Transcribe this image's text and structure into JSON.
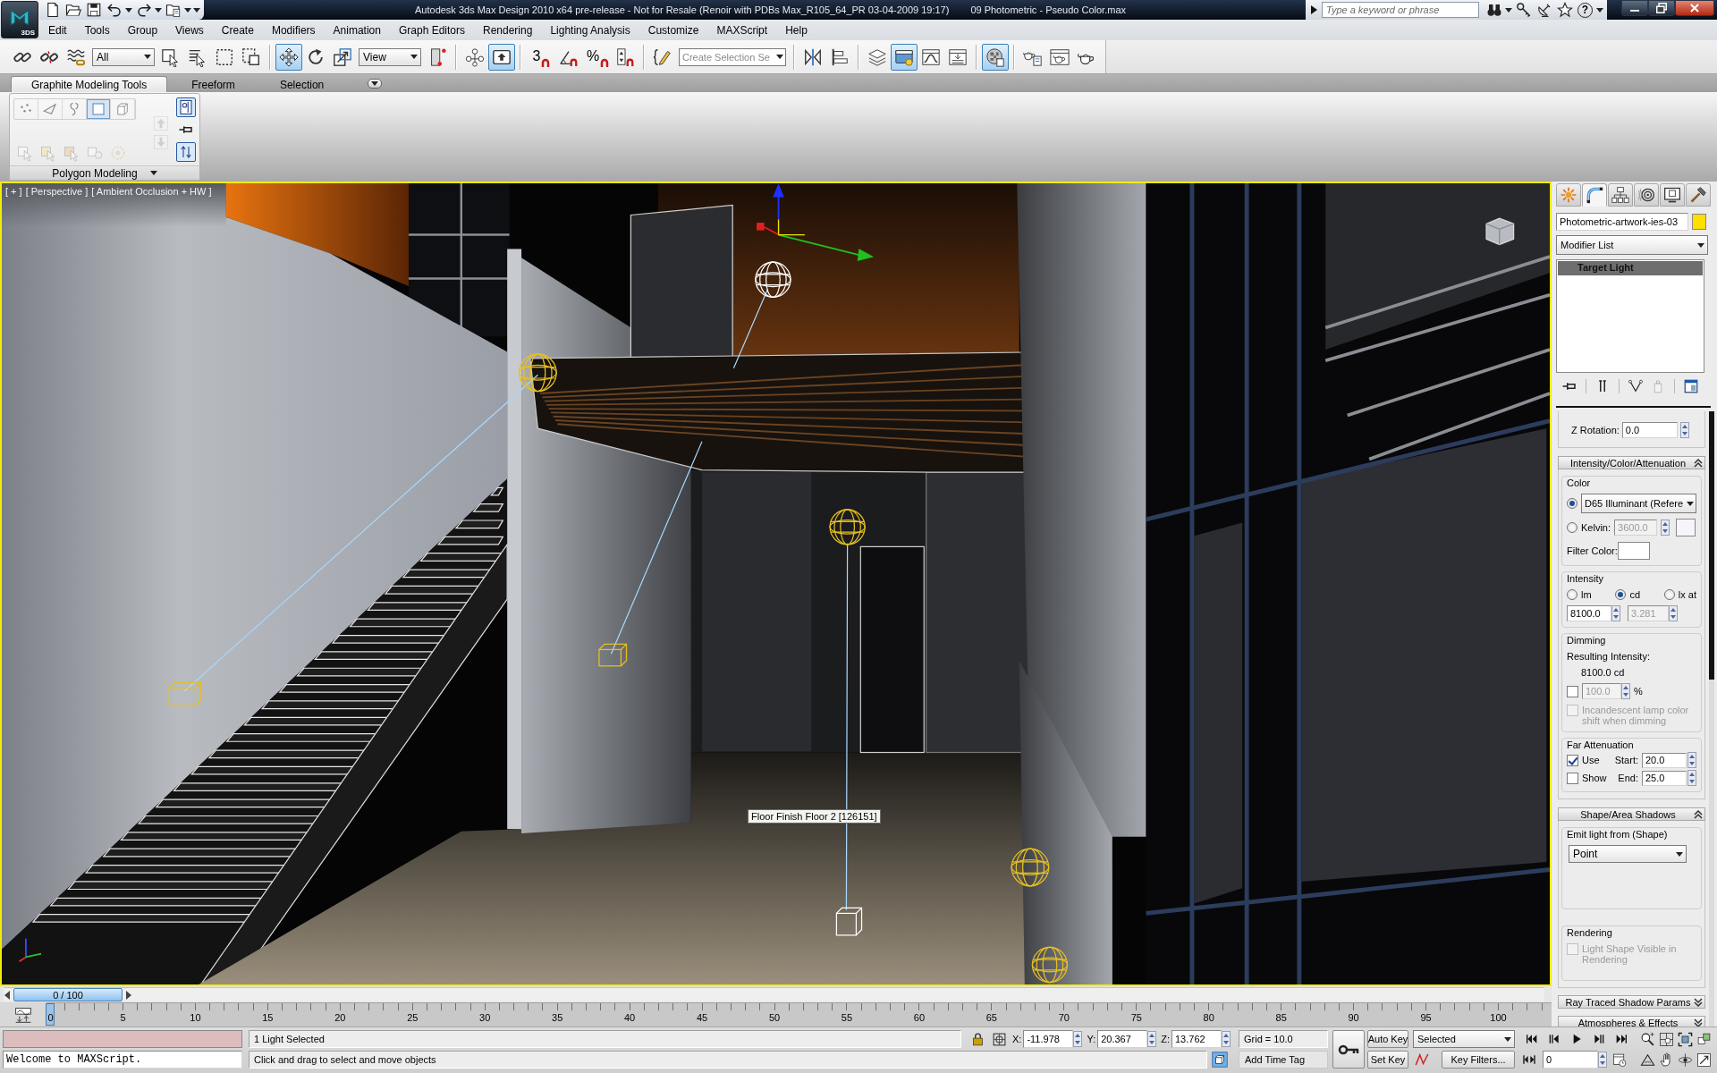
{
  "title_bar": {
    "app_button": {
      "label": "3DS"
    },
    "quick_access": [
      {
        "kind": "new"
      },
      {
        "kind": "open"
      },
      {
        "kind": "save"
      },
      {
        "kind": "undo",
        "menu": true
      },
      {
        "kind": "redo",
        "menu": true
      },
      {
        "kind": "project",
        "menu": true
      },
      {
        "kind": "customize"
      }
    ],
    "title": "Autodesk 3ds Max Design 2010 x64 pre-release - Not for Resale (Renoir with PDBs Max_R105_64_PR 03-04-2009 19:17)",
    "file_name": "09 Photometric - Pseudo Color.max",
    "search": {
      "placeholder": "Type a keyword or phrase"
    },
    "infocenter": [
      {
        "kind": "binoculars",
        "menu": true
      },
      {
        "kind": "key"
      },
      {
        "kind": "satellite"
      },
      {
        "kind": "star"
      },
      {
        "kind": "help",
        "glyph": "?",
        "menu": true
      }
    ]
  },
  "menu_bar": [
    "Edit",
    "Tools",
    "Group",
    "Views",
    "Create",
    "Modifiers",
    "Animation",
    "Graph Editors",
    "Rendering",
    "Lighting Analysis",
    "Customize",
    "MAXScript",
    "Help"
  ],
  "main_toolbar": {
    "groups": [
      [
        {
          "kind": "link",
          "selected": false
        },
        {
          "kind": "unlink",
          "selected": false
        },
        {
          "kind": "bind",
          "selected": false
        },
        {
          "kind": "dropdown",
          "value": "All"
        },
        {
          "kind": "select_object",
          "selected": false
        },
        {
          "kind": "select_by_name",
          "selected": false
        },
        {
          "kind": "rect_region",
          "selected": false
        },
        {
          "kind": "window_crossing",
          "selected": false
        }
      ],
      [
        {
          "kind": "move",
          "selected": true
        },
        {
          "kind": "rotate",
          "selected": false
        },
        {
          "kind": "scale",
          "selected": false
        },
        {
          "kind": "dropdown",
          "value": "View"
        },
        {
          "kind": "pivot",
          "selected": false
        }
      ],
      [
        {
          "kind": "manipulate",
          "selected": false
        },
        {
          "kind": "keyboard_override",
          "selected": true
        }
      ],
      [
        {
          "kind": "snap",
          "glyph": "3",
          "selected": false
        },
        {
          "kind": "angle_snap",
          "selected": false
        },
        {
          "kind": "snap",
          "glyph": "%",
          "selected": false
        },
        {
          "kind": "spinner_snap",
          "selected": false
        }
      ],
      [
        {
          "kind": "named_selection",
          "selected": false
        },
        {
          "kind": "combo",
          "placeholder": "Create Selection Se"
        }
      ],
      [
        {
          "kind": "mirror",
          "selected": false
        },
        {
          "kind": "align",
          "selected": false
        }
      ],
      [
        {
          "kind": "layers",
          "selected": false
        },
        {
          "kind": "graphite",
          "selected": true
        },
        {
          "kind": "curve_editor",
          "selected": false
        },
        {
          "kind": "schematic",
          "selected": false
        }
      ],
      [
        {
          "kind": "material_editor",
          "selected": true
        }
      ],
      [
        {
          "kind": "render_setup",
          "selected": false
        },
        {
          "kind": "render_frame",
          "selected": false
        },
        {
          "kind": "render",
          "selected": false
        }
      ]
    ]
  },
  "ribbon": {
    "tabs": [
      {
        "label": "Graphite Modeling Tools",
        "selected": true
      },
      {
        "label": "Freeform",
        "selected": false
      },
      {
        "label": "Selection",
        "selected": false
      }
    ],
    "panel": {
      "title": "Polygon Modeling",
      "subobjects": [
        {
          "kind": "vertex",
          "selected": false
        },
        {
          "kind": "edge",
          "selected": false
        },
        {
          "kind": "border",
          "selected": false
        },
        {
          "kind": "polygon",
          "selected": true
        },
        {
          "kind": "element",
          "selected": false
        }
      ],
      "commands": [
        {
          "kind": "cursor_box",
          "disabled": true
        },
        {
          "kind": "cursor_box_yellow",
          "disabled": true
        },
        {
          "kind": "cursor_box_orange",
          "disabled": true
        },
        {
          "kind": "box_bulb",
          "disabled": true
        },
        {
          "kind": "dotted_ring",
          "disabled": true
        }
      ],
      "stack_arrows": [
        {
          "kind": "up",
          "disabled": true
        },
        {
          "kind": "down",
          "disabled": true
        }
      ],
      "options": [
        {
          "kind": "panel_toggle",
          "selected": true
        },
        {
          "kind": "pin",
          "selected": false
        },
        {
          "kind": "up_down",
          "selected": true
        }
      ]
    }
  },
  "viewport": {
    "active": true,
    "labels": [
      "[ + ]",
      "[ Perspective ]",
      "[ Ambient Occlusion + HW ]"
    ],
    "tooltip": "Floor Finish Floor 2 [126151]"
  },
  "command_panel": {
    "tabs": [
      {
        "kind": "create",
        "selected": false
      },
      {
        "kind": "modify",
        "selected": true
      },
      {
        "kind": "hierarchy",
        "selected": false
      },
      {
        "kind": "motion",
        "selected": false
      },
      {
        "kind": "display",
        "selected": false
      },
      {
        "kind": "utilities",
        "selected": false
      }
    ],
    "object": {
      "name": "Photometric-artwork-ies-03",
      "color": "#ffde00"
    },
    "modifier_list": "Modifier List",
    "stack": [
      {
        "label": "Target Light",
        "selected": true
      }
    ],
    "stack_tools": [
      {
        "kind": "pin",
        "disabled": false
      },
      {
        "kind": "end_result",
        "disabled": false
      },
      {
        "kind": "make_unique",
        "disabled": false
      },
      {
        "kind": "remove",
        "disabled": true
      },
      {
        "kind": "configure",
        "disabled": false
      }
    ],
    "rotation": {
      "label": "Z Rotation:",
      "value": "0.0"
    },
    "intensity_rollout": {
      "title": "Intensity/Color/Attenuation",
      "expanded": true,
      "color": {
        "title": "Color",
        "preset": {
          "selected": true,
          "value": "D65 Illuminant (Refere"
        },
        "kelvin": {
          "selected": false,
          "label": "Kelvin:",
          "value": "3600.0",
          "disabled": true
        },
        "filter_label": "Filter Color:"
      },
      "intensity": {
        "title": "Intensity",
        "units": [
          {
            "label": "lm",
            "selected": false
          },
          {
            "label": "cd",
            "selected": true
          },
          {
            "label": "lx at",
            "selected": false
          }
        ],
        "value": "8100.0",
        "distance": {
          "value": "3.281",
          "disabled": true
        }
      },
      "dimming": {
        "title": "Dimming",
        "result_label": "Resulting Intensity:",
        "result": "8100.0 cd",
        "percent": {
          "checked": false,
          "value": "100.0",
          "disabled": true,
          "unit": "%"
        },
        "incandescent": {
          "label": "Incandescent lamp color shift when dimming",
          "checked": false,
          "disabled": true
        }
      },
      "far_attenuation": {
        "title": "Far Attenuation",
        "rows": [
          {
            "label": "Use",
            "checked": true,
            "field_label": "Start:",
            "value": "20.0"
          },
          {
            "label": "Show",
            "checked": false,
            "field_label": "End:",
            "value": "25.0"
          }
        ]
      }
    },
    "shape_rollout": {
      "title": "Shape/Area Shadows",
      "expanded": true,
      "emit": {
        "title": "Emit light from (Shape)",
        "value": "Point"
      },
      "rendering": {
        "title": "Rendering",
        "label": "Light Shape Visible in Rendering",
        "checked": false,
        "disabled": true
      }
    },
    "more_rollouts": [
      {
        "title": "Ray Traced Shadow Params",
        "expanded": false
      },
      {
        "title": "Atmospheres & Effects",
        "expanded": false
      }
    ]
  },
  "time_slider": {
    "label": "0 / 100",
    "level": 0
  },
  "track_bar": {
    "ticks": [
      "0",
      "5",
      "10",
      "15",
      "20",
      "25",
      "30",
      "35",
      "40",
      "45",
      "50",
      "55",
      "60",
      "65",
      "70",
      "75",
      "80",
      "85",
      "90",
      "95",
      "100"
    ]
  },
  "status_bar": {
    "listener_output": "Welcome to MAXScript.",
    "selection": "1 Light Selected",
    "prompt": "Click and drag to select and move objects",
    "coordinates": [
      {
        "label": "X:",
        "value": "-11.978"
      },
      {
        "label": "Y:",
        "value": "20.367"
      },
      {
        "label": "Z:",
        "value": "13.762"
      }
    ],
    "grid": "Grid = 10.0",
    "time_tag": "Add Time Tag",
    "auto_key": {
      "label": "Auto Key",
      "on": false
    },
    "set_key": "Set Key",
    "key_set": "Selected",
    "key_filters": "Key Filters...",
    "frame": "0"
  }
}
